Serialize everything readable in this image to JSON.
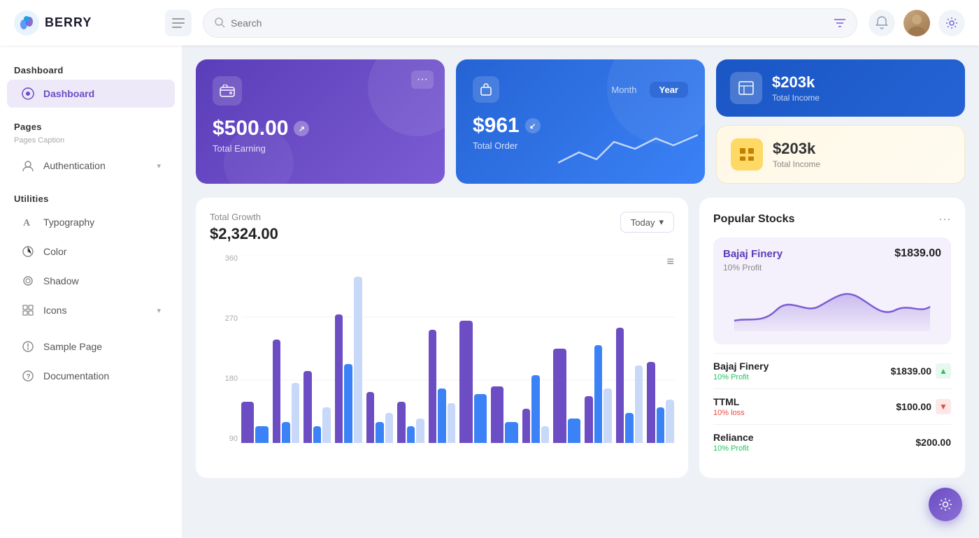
{
  "app": {
    "name": "BERRY"
  },
  "header": {
    "search_placeholder": "Search",
    "hamburger_label": "☰"
  },
  "sidebar": {
    "section_dashboard": "Dashboard",
    "dashboard_item": "Dashboard",
    "section_pages": "Pages",
    "pages_caption": "Pages Caption",
    "auth_item": "Authentication",
    "section_utilities": "Utilities",
    "typography_item": "Typography",
    "color_item": "Color",
    "shadow_item": "Shadow",
    "icons_item": "Icons",
    "sample_page_item": "Sample Page",
    "documentation_item": "Documentation"
  },
  "cards": {
    "earning": {
      "amount": "$500.00",
      "label": "Total Earning"
    },
    "order": {
      "amount": "$961",
      "label": "Total Order",
      "tab_month": "Month",
      "tab_year": "Year"
    },
    "income_blue": {
      "amount": "$203k",
      "label": "Total Income"
    },
    "income_yellow": {
      "amount": "$203k",
      "label": "Total Income"
    }
  },
  "growth_chart": {
    "title": "Total Growth",
    "amount": "$2,324.00",
    "filter_btn": "Today",
    "y_labels": [
      "360",
      "270",
      "180",
      "90"
    ],
    "bars": [
      {
        "purple": 20,
        "blue": 8,
        "light": 0
      },
      {
        "purple": 55,
        "blue": 10,
        "light": 30
      },
      {
        "purple": 38,
        "blue": 8,
        "light": 18
      },
      {
        "purple": 70,
        "blue": 40,
        "light": 85
      },
      {
        "purple": 28,
        "blue": 10,
        "light": 15
      },
      {
        "purple": 22,
        "blue": 8,
        "light": 12
      },
      {
        "purple": 60,
        "blue": 28,
        "light": 20
      },
      {
        "purple": 65,
        "blue": 25,
        "light": 0
      },
      {
        "purple": 30,
        "blue": 10,
        "light": 0
      },
      {
        "purple": 18,
        "blue": 35,
        "light": 8
      },
      {
        "purple": 50,
        "blue": 12,
        "light": 0
      },
      {
        "purple": 25,
        "blue": 50,
        "light": 28
      },
      {
        "purple": 60,
        "blue": 15,
        "light": 40
      },
      {
        "purple": 42,
        "blue": 18,
        "light": 22
      }
    ]
  },
  "stocks": {
    "title": "Popular Stocks",
    "featured": {
      "name": "Bajaj Finery",
      "price": "$1839.00",
      "profit_label": "10% Profit"
    },
    "list": [
      {
        "name": "Bajaj Finery",
        "sub": "10% Profit",
        "price": "$1839.00",
        "trend": "up",
        "sub_color": "#22c55e"
      },
      {
        "name": "TTML",
        "sub": "10% loss",
        "price": "$100.00",
        "trend": "down",
        "sub_color": "#ef4444"
      },
      {
        "name": "Reliance",
        "sub": "10% Profit",
        "price": "$200.00",
        "trend": "up",
        "sub_color": "#22c55e"
      }
    ]
  }
}
